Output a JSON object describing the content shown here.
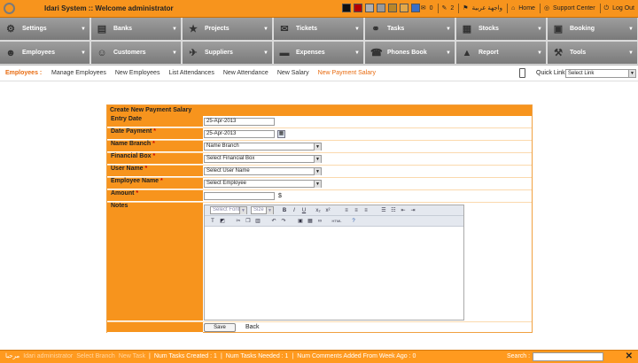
{
  "app": {
    "logo": "idari",
    "title": "Idari System :: Welcome administrator"
  },
  "swatch_colors": [
    "#111111",
    "#b40000",
    "#b0b0b0",
    "#999999",
    "#b8862b",
    "#e3a84a",
    "#3a6fc7"
  ],
  "topbar": {
    "count_a": "0",
    "count_b": "2",
    "language": "واجهة عربية",
    "home": "Home",
    "support": "Support Center",
    "logout": "Log Out"
  },
  "menu": [
    {
      "label": "Settings",
      "icon": "wrench-icon",
      "glyph": "⚙"
    },
    {
      "label": "Banks",
      "icon": "bank-icon",
      "glyph": "▤"
    },
    {
      "label": "Projects",
      "icon": "star-icon",
      "glyph": "★"
    },
    {
      "label": "Tickets",
      "icon": "ticket-icon",
      "glyph": "✉"
    },
    {
      "label": "Tasks",
      "icon": "tasks-icon",
      "glyph": "⚭"
    },
    {
      "label": "Stocks",
      "icon": "truck-icon",
      "glyph": "▦"
    },
    {
      "label": "Booking",
      "icon": "calendar-icon",
      "glyph": "▣"
    },
    {
      "label": "Employees",
      "icon": "employees-icon",
      "glyph": "☻"
    },
    {
      "label": "Customers",
      "icon": "customer-icon",
      "glyph": "☺"
    },
    {
      "label": "Suppliers",
      "icon": "suppliers-icon",
      "glyph": "✈"
    },
    {
      "label": "Expenses",
      "icon": "briefcase-icon",
      "glyph": "▬"
    },
    {
      "label": "Phones Book",
      "icon": "phone-book-icon",
      "glyph": "☎"
    },
    {
      "label": "Report",
      "icon": "report-icon",
      "glyph": "▲"
    },
    {
      "label": "Tools",
      "icon": "tools-icon",
      "glyph": "⚒"
    }
  ],
  "subnav": {
    "section": "Employees :",
    "items": [
      "Manage Employees",
      "New Employees",
      "List Attendances",
      "New Attendance",
      "New Salary",
      "New Payment Salary"
    ],
    "active": 5,
    "quick_link_label": "Quick Link:",
    "quick_link_value": "Select Link"
  },
  "form": {
    "title": "Create New Payment Salary",
    "entry_date": {
      "label": "Entry Date",
      "value": "25-Apr-2013"
    },
    "date_payment": {
      "label": "Date Payment",
      "value": "25-Apr-2013"
    },
    "name_branch": {
      "label": "Name Branch",
      "value": "Name Branch"
    },
    "financial_box": {
      "label": "Financial Box",
      "value": "Select Financial Box"
    },
    "user_name": {
      "label": "User Name",
      "value": "Select User Name"
    },
    "employee_name": {
      "label": "Employee Name",
      "value": "Select Employee"
    },
    "amount": {
      "label": "Amount",
      "value": "",
      "currency": "$"
    },
    "notes": {
      "label": "Notes",
      "font_placeholder": "Select Font",
      "size_placeholder": "Size",
      "html_label": "HTML"
    },
    "save": "Save",
    "back": "Back",
    "required_mark": "*"
  },
  "footer": {
    "ticker": "مرحبا",
    "user": "Idari administrator",
    "mid1": "Select Branch",
    "mid2": "New Task",
    "created": "Num Tasks Created : 1",
    "needed": "Num Tasks Needed : 1",
    "comments": "Num Comments Added From Week Ago : 0",
    "search": "Search :"
  }
}
